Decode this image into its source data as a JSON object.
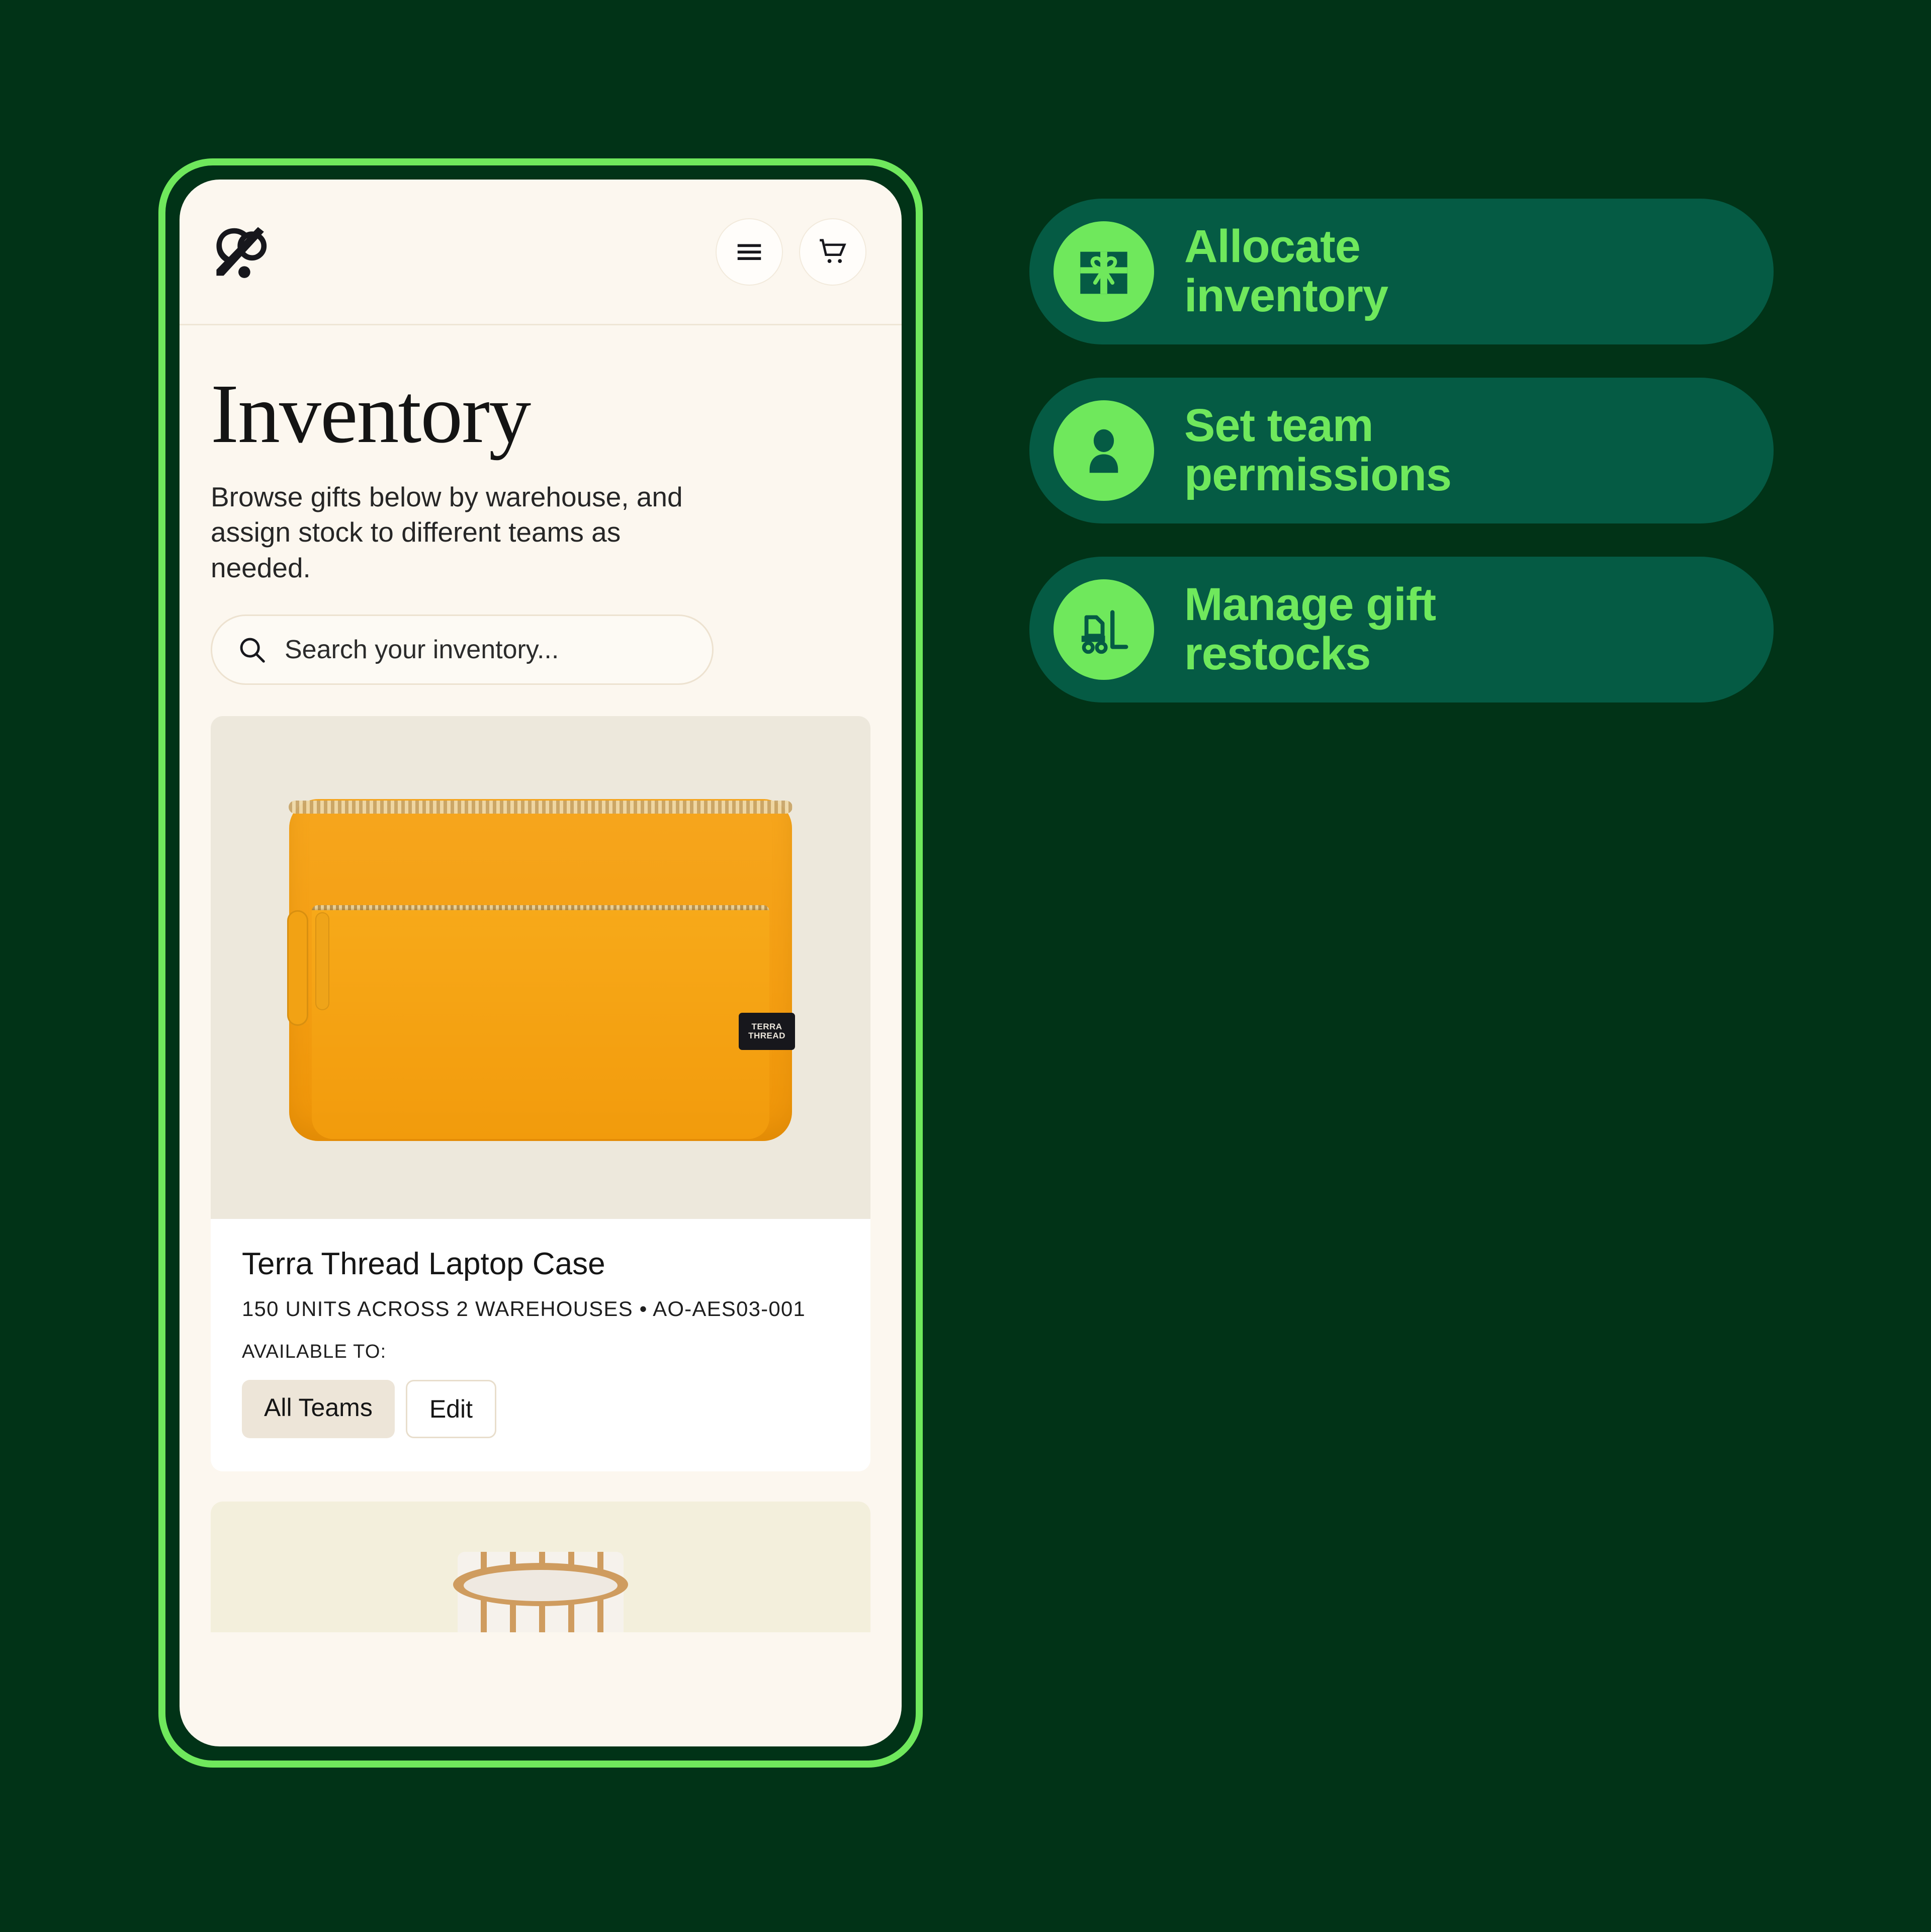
{
  "colors": {
    "page_background": "#013317",
    "phone_outline": "#6FE85C",
    "screen_background": "#FCF7EF",
    "pill_background": "#055B44",
    "accent_green": "#6FE85C",
    "product_orange": "#F5A316"
  },
  "phone": {
    "header": {
      "logo_name": "logo-mark",
      "menu_button_label": "Menu",
      "cart_button_label": "Cart"
    },
    "page_title": "Inventory",
    "page_subtitle": "Browse gifts below by warehouse, and assign stock to different teams as needed.",
    "search": {
      "placeholder": "Search your inventory...",
      "icon": "search-icon"
    },
    "products": [
      {
        "name": "Terra Thread Laptop Case",
        "meta": "150 UNITS ACROSS 2 WAREHOUSES • AO-AES03-001",
        "available_label": "AVAILABLE TO:",
        "team_chip": "All Teams",
        "edit_chip": "Edit",
        "brand_tag": "TERRA THREAD"
      },
      {
        "name": "",
        "meta": ""
      }
    ]
  },
  "features": [
    {
      "icon": "gift-box-icon",
      "label_line1": "Allocate",
      "label_line2": "inventory"
    },
    {
      "icon": "user-person-icon",
      "label_line1": "Set team",
      "label_line2": "permissions"
    },
    {
      "icon": "forklift-icon",
      "label_line1": "Manage gift",
      "label_line2": "restocks"
    }
  ]
}
